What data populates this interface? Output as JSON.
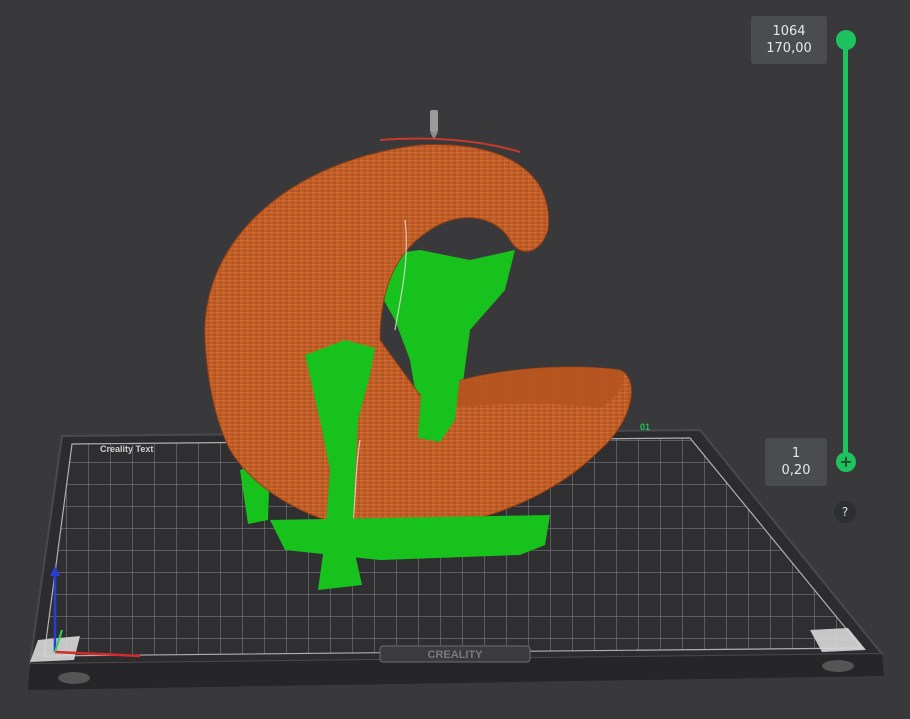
{
  "layer_slider": {
    "top": {
      "layer": "1064",
      "height": "170,00"
    },
    "bottom": {
      "layer": "1",
      "height": "0,20"
    },
    "add_symbol": "+",
    "help_label": "?"
  },
  "bed": {
    "brand": "CREALITY",
    "corner_label_top_left": "Creality Text",
    "corner_label_top_right": "01"
  },
  "colors": {
    "background": "#39393c",
    "slider_accent": "#1ec25f",
    "model": "#c7622a",
    "supports": "#18c21c",
    "bed_grid": "#8c8c8c"
  },
  "icons": {
    "axis_gizmo": "axis-icon",
    "nozzle": "nozzle-icon",
    "fingerprint": "fingerprint-icon"
  }
}
